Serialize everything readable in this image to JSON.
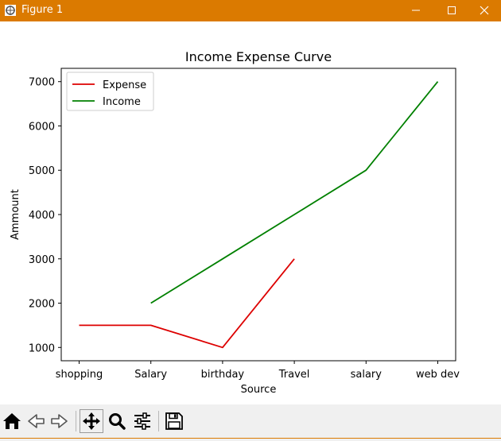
{
  "window": {
    "title": "Figure 1"
  },
  "toolbar": {
    "buttons": [
      {
        "name": "home",
        "icon": "home-icon"
      },
      {
        "name": "back",
        "icon": "back-arrow-icon"
      },
      {
        "name": "forward",
        "icon": "forward-arrow-icon"
      },
      {
        "name": "pan",
        "icon": "move-icon"
      },
      {
        "name": "zoom",
        "icon": "magnifier-icon"
      },
      {
        "name": "configure-subplots",
        "icon": "sliders-icon"
      },
      {
        "name": "save",
        "icon": "floppy-disk-icon"
      }
    ]
  },
  "chart_data": {
    "type": "line",
    "title": "Income Expense Curve",
    "xlabel": "Source",
    "ylabel": "Ammount",
    "categories": [
      "shopping",
      "Salary",
      "birthday",
      "Travel",
      "salary",
      "web dev"
    ],
    "ylim": [
      700,
      7300
    ],
    "yticks": [
      1000,
      2000,
      3000,
      4000,
      5000,
      6000,
      7000
    ],
    "grid": false,
    "legend_position": "top-left",
    "series": [
      {
        "name": "Expense",
        "color": "#dd0000",
        "points": [
          [
            0,
            1500
          ],
          [
            1,
            1500
          ],
          [
            2,
            1000
          ],
          [
            3,
            3000
          ]
        ]
      },
      {
        "name": "Income",
        "color": "#008000",
        "points": [
          [
            1,
            2000
          ],
          [
            2,
            3000
          ],
          [
            3,
            4000
          ],
          [
            4,
            5000
          ],
          [
            5,
            7000
          ]
        ]
      }
    ]
  }
}
